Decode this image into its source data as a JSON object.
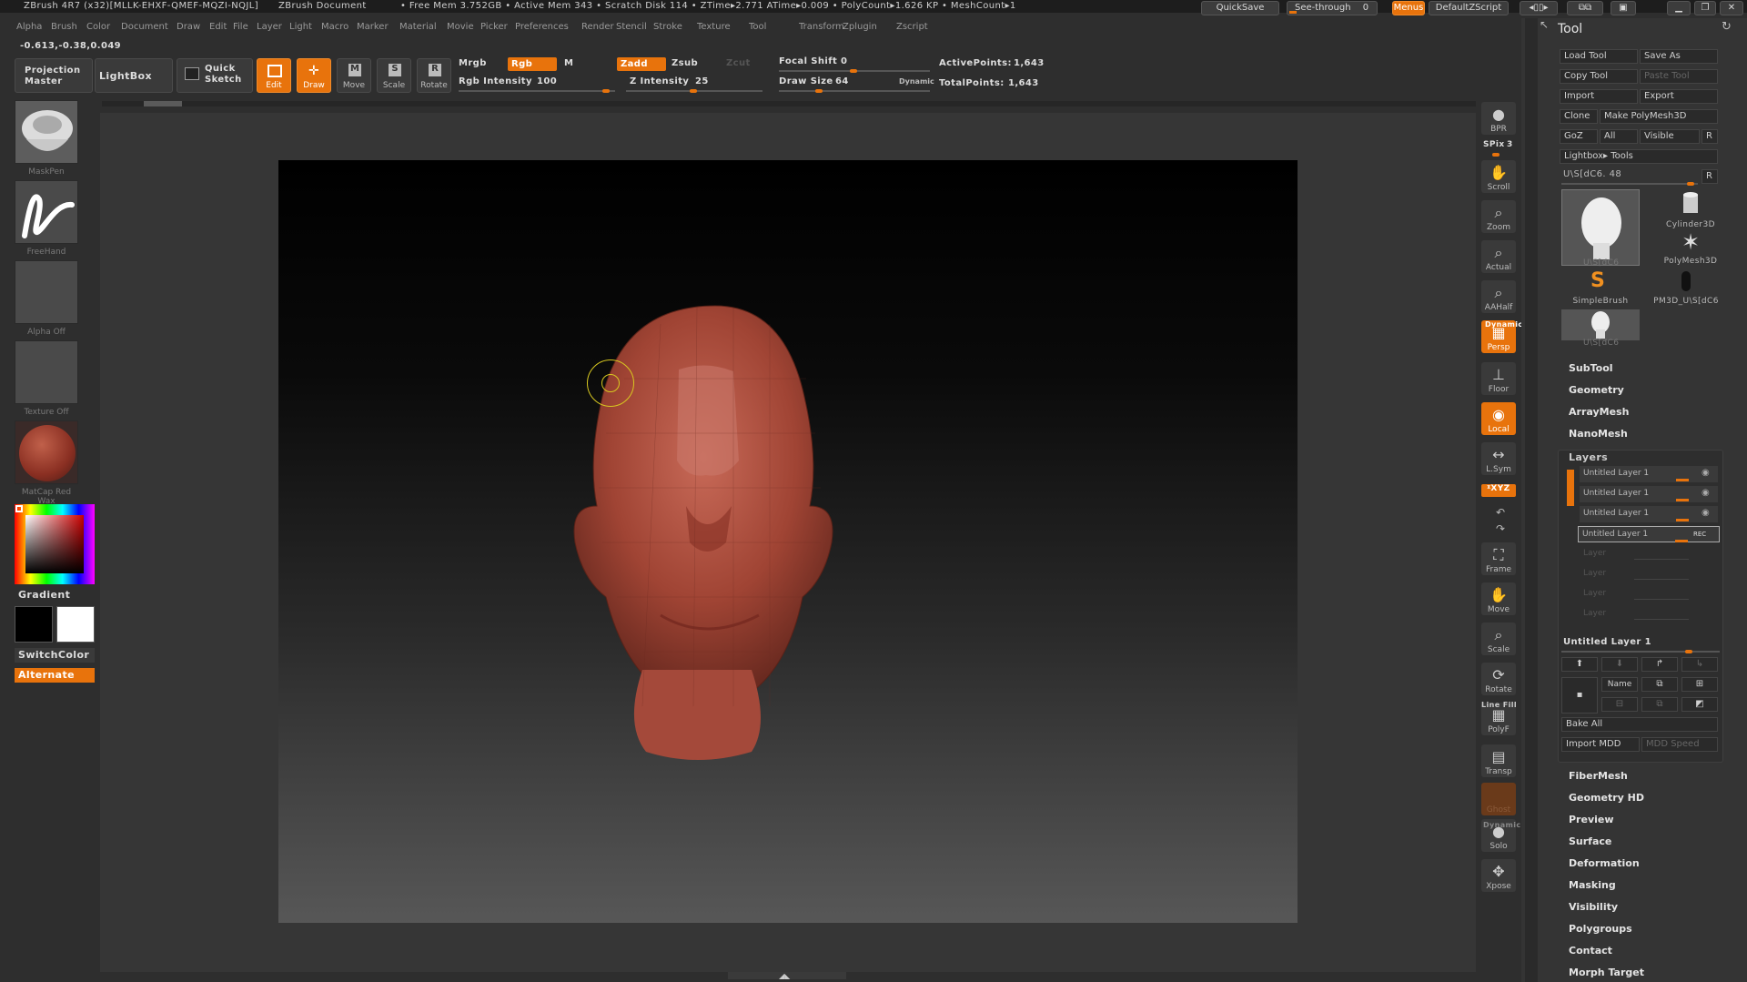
{
  "titlebar": {
    "app_title": "ZBrush 4R7 (x32)[MLLK-EHXF-QMEF-MQZI-NQJL]",
    "document": "ZBrush Document",
    "stats": "• Free Mem 3.752GB • Active Mem 343 • Scratch Disk 114 • ZTime▸2.771 ATime▸0.009 • PolyCount▸1.626 KP • MeshCount▸1",
    "quicksave": "QuickSave",
    "see_through": "See-through",
    "see_through_value": "0",
    "menus": "Menus",
    "script": "DefaultZScript"
  },
  "menus": [
    "Alpha",
    "Brush",
    "Color",
    "Document",
    "Draw",
    "Edit",
    "File",
    "Layer",
    "Light",
    "Macro",
    "Marker",
    "Material",
    "Movie",
    "Picker",
    "Preferences",
    "Render",
    "Stencil",
    "Stroke",
    "Texture",
    "Tool",
    "Transform",
    "Zplugin",
    "Zscript"
  ],
  "coords": "-0.613,-0.38,0.049",
  "toolbar": {
    "projection_master": "Projection Master",
    "lightbox": "LightBox",
    "quick_sketch": "Quick Sketch",
    "edit": "Edit",
    "draw": "Draw",
    "move": "Move",
    "scale": "Scale",
    "rotate": "Rotate",
    "mrgb": "Mrgb",
    "rgb": "Rgb",
    "m": "M",
    "rgb_intensity_label": "Rgb Intensity",
    "rgb_intensity_value": "100",
    "zadd": "Zadd",
    "zsub": "Zsub",
    "zcut": "Zcut",
    "z_intensity_label": "Z Intensity",
    "z_intensity_value": "25",
    "focal_shift_label": "Focal Shift",
    "focal_shift_value": "0",
    "draw_size_label": "Draw Size",
    "draw_size_value": "64",
    "dynamic": "Dynamic",
    "active_points_label": "ActivePoints:",
    "active_points": "1,643",
    "total_points_label": "TotalPoints:",
    "total_points": "1,643"
  },
  "left_panel": {
    "brush": "MaskPen",
    "stroke": "FreeHand",
    "alpha": "Alpha Off",
    "texture": "Texture Off",
    "material": "MatCap Red Wax",
    "gradient": "Gradient",
    "switch_color": "SwitchColor",
    "alternate": "Alternate"
  },
  "right_strip": {
    "bpr": "BPR",
    "spix": "SPix",
    "spix_value": "3",
    "scroll": "Scroll",
    "zoom": "Zoom",
    "actual": "Actual",
    "aahalf": "AAHalf",
    "dynamic": "Dynamic",
    "persp": "Persp",
    "floor": "Floor",
    "local": "Local",
    "lsym": "L.Sym",
    "xyz": "ᵡXYZ",
    "frame": "Frame",
    "move": "Move",
    "scale": "Scale",
    "rotate": "Rotate",
    "line_fill": "Line Fill",
    "polyf": "PolyF",
    "transp": "Transp",
    "ghost": "Ghost",
    "solo_dynamic": "Dynamic",
    "solo": "Solo",
    "xpose": "Xpose"
  },
  "tool_panel": {
    "title": "Tool",
    "load_tool": "Load Tool",
    "save_as": "Save As",
    "copy_tool": "Copy Tool",
    "paste_tool": "Paste Tool",
    "import": "Import",
    "export": "Export",
    "clone": "Clone",
    "make_polymesh": "Make PolyMesh3D",
    "goz": "GoZ",
    "all": "All",
    "visible": "Visible",
    "r": "R",
    "lightbox_tools": "Lightbox▸ Tools",
    "current_tool": "U\\S[dC6. 48",
    "tools": [
      "U\\S[dC6",
      "Cylinder3D",
      "PolyMesh3D",
      "SimpleBrush",
      "PM3D_U\\S[dC6",
      "U\\S[dC6"
    ],
    "sections_top": [
      "SubTool",
      "Geometry",
      "ArrayMesh",
      "NanoMesh"
    ],
    "layers_title": "Layers",
    "layers": [
      "Untitled Layer 1",
      "Untitled Layer 1",
      "Untitled Layer 1",
      "Untitled Layer 1"
    ],
    "rec": "REC",
    "empty_layers": [
      "Layer",
      "Layer",
      "Layer",
      "Layer"
    ],
    "selected_layer": "Untitled Layer 1",
    "name_btn": "Name",
    "bake_all": "Bake All",
    "import_mdd": "Import MDD",
    "mdd_speed": "MDD Speed",
    "sections_bottom": [
      "FiberMesh",
      "Geometry HD",
      "Preview",
      "Surface",
      "Deformation",
      "Masking",
      "Visibility",
      "Polygroups",
      "Contact",
      "Morph Target"
    ]
  },
  "colors": {
    "accent": "#e8730c",
    "panel": "#2e2e2e",
    "viewport_top": "#000000",
    "viewport_bottom": "#555555",
    "model": "#a84a3a"
  }
}
